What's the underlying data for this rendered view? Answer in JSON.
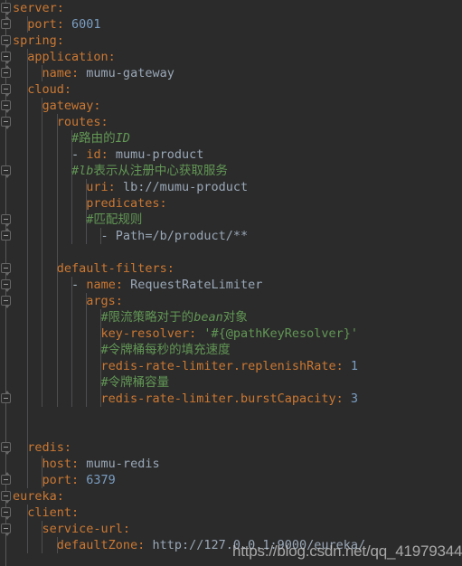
{
  "editor": {
    "theme": "darcula",
    "background": "#2b2b2b",
    "colors": {
      "key": "#cc7832",
      "value": "#9aa8b8",
      "number": "#7a9ec2",
      "comment": "#629755",
      "string": "#629755",
      "punctuation": "#a9b7c6",
      "indent_guide": "#4e4e50",
      "gutter_line": "#595959"
    },
    "language": "yaml",
    "line_height": 18,
    "first_line_top": 0
  },
  "lines": [
    {
      "n": 1,
      "indent": 0,
      "type": "key",
      "key": "server:",
      "value": ""
    },
    {
      "n": 2,
      "indent": 1,
      "type": "key",
      "key": "port:",
      "value": "6001",
      "value_kind": "number"
    },
    {
      "n": 3,
      "indent": 0,
      "type": "key",
      "key": "spring:",
      "value": ""
    },
    {
      "n": 4,
      "indent": 1,
      "type": "key",
      "key": "application:",
      "value": ""
    },
    {
      "n": 5,
      "indent": 2,
      "type": "key",
      "key": "name:",
      "value": "mumu-gateway"
    },
    {
      "n": 6,
      "indent": 1,
      "type": "key",
      "key": "cloud:",
      "value": ""
    },
    {
      "n": 7,
      "indent": 2,
      "type": "key",
      "key": "gateway:",
      "value": ""
    },
    {
      "n": 8,
      "indent": 3,
      "type": "key",
      "key": "routes:",
      "value": ""
    },
    {
      "n": 9,
      "indent": 4,
      "type": "comment",
      "text": "#路由的",
      "text_italic": "ID"
    },
    {
      "n": 10,
      "indent": 4,
      "type": "item",
      "dash": "-",
      "key": "id:",
      "value": "mumu-product"
    },
    {
      "n": 11,
      "indent": 4,
      "type": "comment",
      "text_italic_lead": "#lb",
      "text": "表示从注册中心获取服务"
    },
    {
      "n": 12,
      "indent": 5,
      "type": "key",
      "key": "uri:",
      "value": "lb://mumu-product"
    },
    {
      "n": 13,
      "indent": 5,
      "type": "key",
      "key": "predicates:",
      "value": ""
    },
    {
      "n": 14,
      "indent": 5,
      "type": "comment",
      "text": "#匹配规则"
    },
    {
      "n": 15,
      "indent": 6,
      "type": "raw",
      "text": "- Path=/b/product/**"
    },
    {
      "n": 16,
      "indent": 0,
      "type": "blank"
    },
    {
      "n": 17,
      "indent": 3,
      "type": "key",
      "key": "default-filters:",
      "value": ""
    },
    {
      "n": 18,
      "indent": 4,
      "type": "item",
      "dash": "-",
      "key": "name:",
      "value": "RequestRateLimiter"
    },
    {
      "n": 19,
      "indent": 5,
      "type": "key",
      "key": "args:",
      "value": ""
    },
    {
      "n": 20,
      "indent": 6,
      "type": "comment",
      "text": "#限流策略对于的",
      "text_italic": "bean",
      "text_tail": "对象"
    },
    {
      "n": 21,
      "indent": 6,
      "type": "string",
      "key": "key-resolver:",
      "value": "'#{@pathKeyResolver}'"
    },
    {
      "n": 22,
      "indent": 6,
      "type": "comment",
      "text": "#令牌桶每秒的填充速度"
    },
    {
      "n": 23,
      "indent": 6,
      "type": "key",
      "key": "redis-rate-limiter.replenishRate:",
      "value": "1",
      "value_kind": "number"
    },
    {
      "n": 24,
      "indent": 6,
      "type": "comment",
      "text": "#令牌桶容量"
    },
    {
      "n": 25,
      "indent": 6,
      "type": "key",
      "key": "redis-rate-limiter.burstCapacity:",
      "value": "3",
      "value_kind": "number"
    },
    {
      "n": 26,
      "indent": 0,
      "type": "blank"
    },
    {
      "n": 27,
      "indent": 0,
      "type": "blank"
    },
    {
      "n": 28,
      "indent": 1,
      "type": "key",
      "key": "redis:",
      "value": ""
    },
    {
      "n": 29,
      "indent": 2,
      "type": "key",
      "key": "host:",
      "value": "mumu-redis"
    },
    {
      "n": 30,
      "indent": 2,
      "type": "key",
      "key": "port:",
      "value": "6379",
      "value_kind": "number"
    },
    {
      "n": 31,
      "indent": 0,
      "type": "key",
      "key": "eureka:",
      "value": ""
    },
    {
      "n": 32,
      "indent": 1,
      "type": "key",
      "key": "client:",
      "value": ""
    },
    {
      "n": 33,
      "indent": 2,
      "type": "key",
      "key": "service-url:",
      "value": ""
    },
    {
      "n": 34,
      "indent": 3,
      "type": "key",
      "key": "defaultZone:",
      "value": "http://127.0.0.1:9000/eureka/"
    }
  ],
  "watermark": {
    "text": "https://blog.csdn.net/qq_41979344"
  }
}
